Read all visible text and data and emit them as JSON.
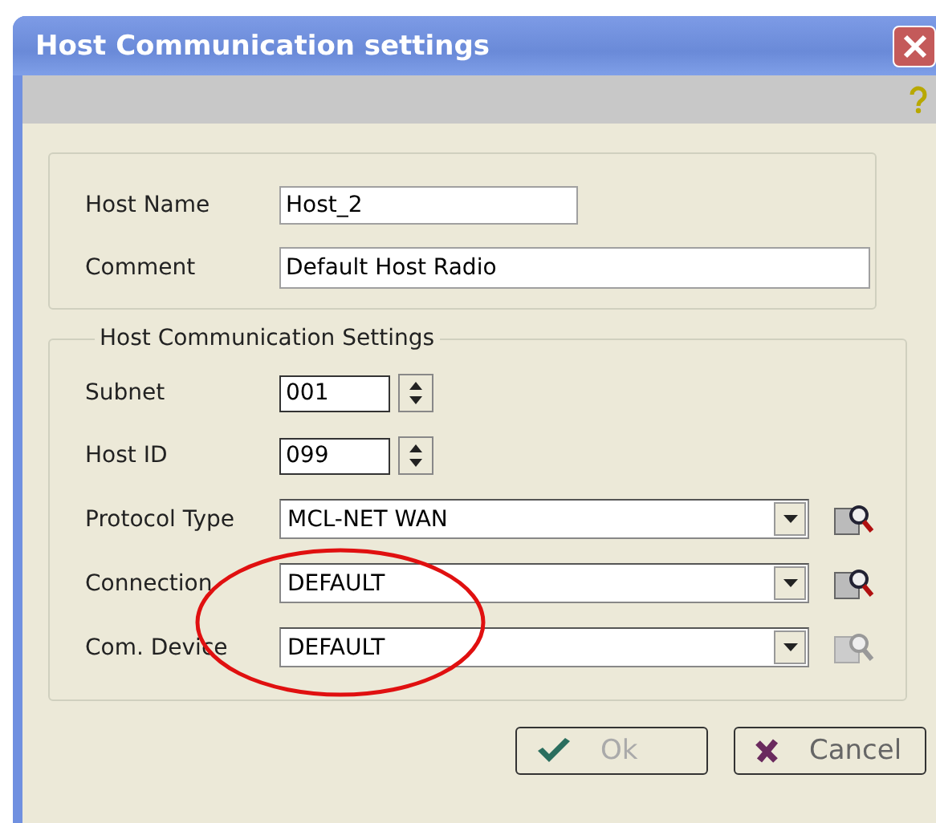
{
  "window": {
    "title": "Host Communication settings"
  },
  "host": [
    {
      "label": "Host Name",
      "value": "Host_2",
      "kind": "short"
    },
    {
      "label": "Comment",
      "value": "Default Host Radio",
      "kind": "wide"
    }
  ],
  "settings": {
    "title": "Host Communication Settings",
    "rows": [
      {
        "label": "Subnet",
        "value": "001",
        "kind": "spin"
      },
      {
        "label": "Host ID",
        "value": "099",
        "kind": "spin"
      },
      {
        "label": "Protocol Type",
        "value": "MCL-NET WAN",
        "kind": "combo",
        "lookup_disabled": false
      },
      {
        "label": "Connection",
        "value": "DEFAULT",
        "kind": "combo",
        "lookup_disabled": false
      },
      {
        "label": "Com. Device",
        "value": "DEFAULT",
        "kind": "combo",
        "lookup_disabled": true
      }
    ]
  },
  "buttons": [
    {
      "label": "Ok",
      "kind": "ok",
      "disabled": true
    },
    {
      "label": "Cancel",
      "kind": "cancel",
      "disabled": false
    }
  ]
}
